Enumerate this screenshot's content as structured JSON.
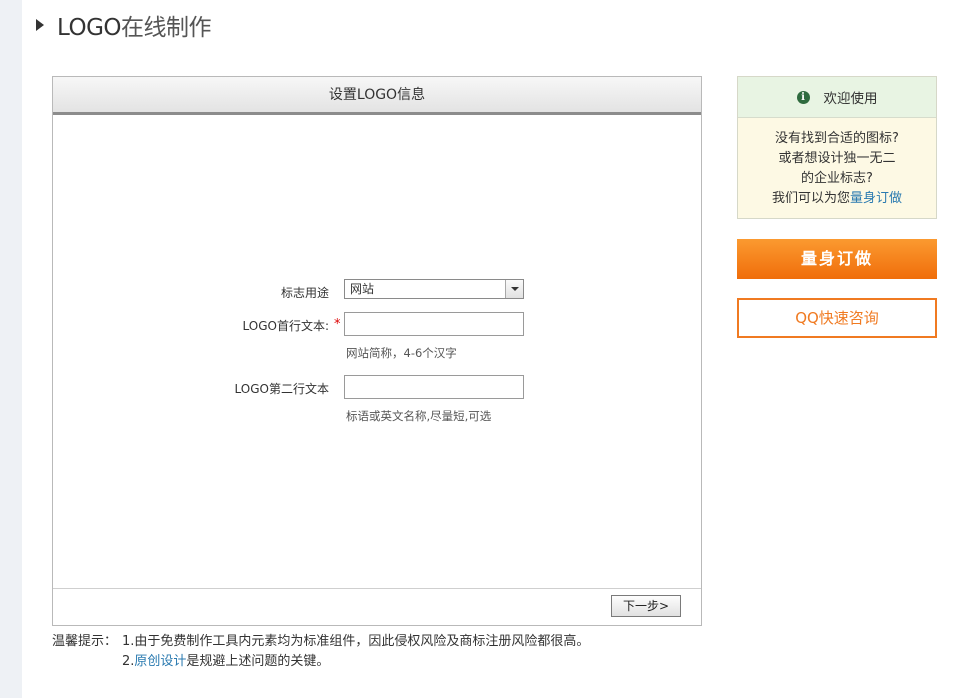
{
  "header": {
    "title_main": "LOGO",
    "title_sub": "在线制作"
  },
  "panel": {
    "title": "设置LOGO信息",
    "usage": {
      "label": "标志用途",
      "selected": "网站"
    },
    "line1": {
      "label": "LOGO首行文本:",
      "required_mark": "*",
      "value": "",
      "hint": "网站简称，4-6个汉字"
    },
    "line2": {
      "label": "LOGO第二行文本",
      "value": "",
      "hint": "标语或英文名称,尽量短,可选"
    },
    "next_label": "下一步>"
  },
  "tips": {
    "label": "温馨提示：",
    "line1": "1.由于免费制作工具内元素均为标准组件，因此侵权风险及商标注册风险都很高。",
    "line2_prefix": "2.",
    "line2_link": "原创设计",
    "line2_suffix": "是规避上述问题的关键。"
  },
  "welcome": {
    "title": "欢迎使用",
    "line1": "没有找到合适的图标?",
    "line2": "或者想设计独一无二",
    "line3": "的企业标志?",
    "line4_prefix": "我们可以为您",
    "line4_link": "量身订做"
  },
  "buttons": {
    "custom": "量身订做",
    "qq": "QQ快速咨询"
  },
  "icons": {
    "header": "caret-right-icon",
    "welcome": "info-icon",
    "select": "chevron-down-icon"
  },
  "colors": {
    "accent_orange": "#f07a21",
    "link_blue": "#2a7ab0",
    "required_red": "#dd0000"
  }
}
